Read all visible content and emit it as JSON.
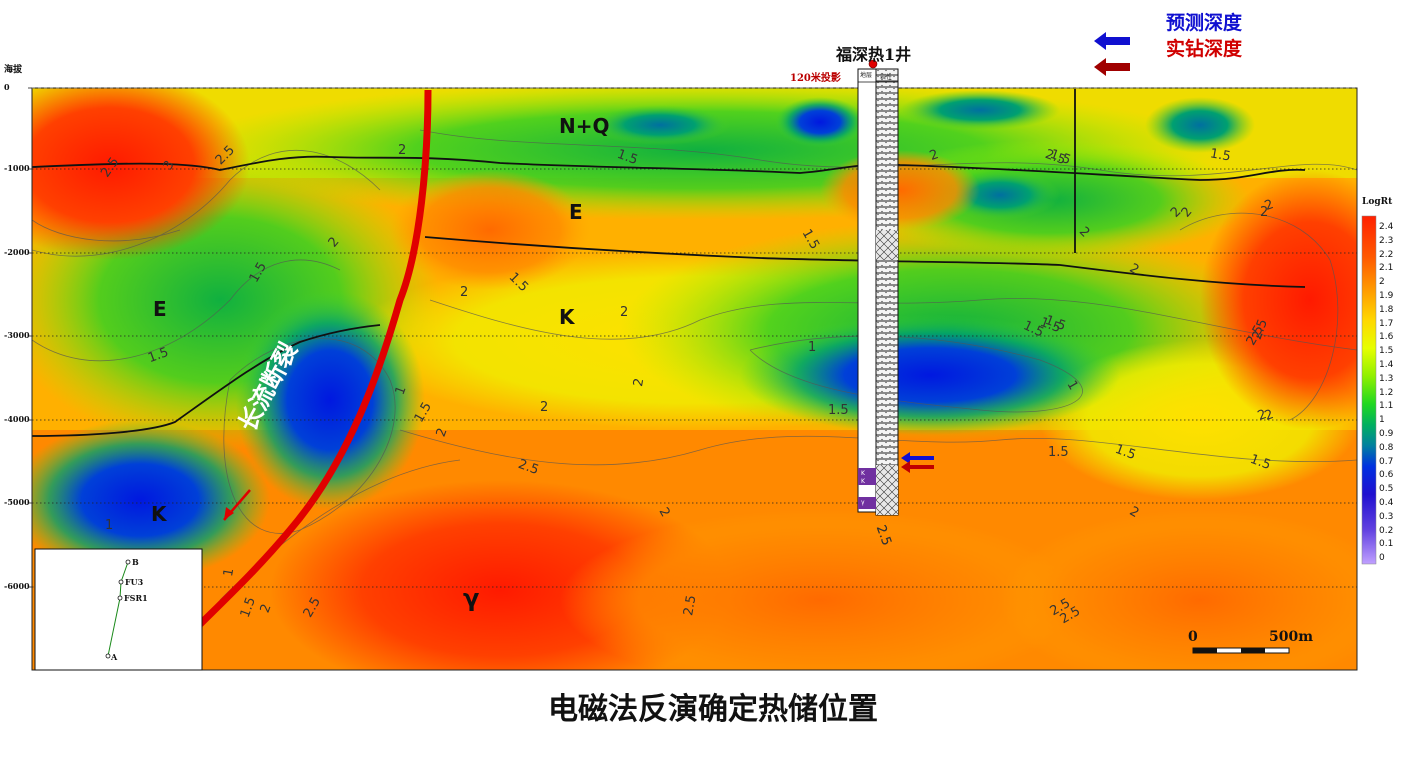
{
  "caption": "电磁法反演确定热储位置",
  "legend": {
    "predicted": "预测深度",
    "predicted_color": "#1010d0",
    "actual": "实钻深度",
    "actual_color": "#c00000"
  },
  "well": {
    "name": "福深热1井",
    "projection": "120米投影",
    "col_left": "地层",
    "col_right": "岩性"
  },
  "axis": {
    "ylabel": "海拔",
    "ticks": [
      "0",
      "-1000",
      "-2000",
      "-3000",
      "-4000",
      "-5000",
      "-6000"
    ]
  },
  "colorbar": {
    "title": "LogRt",
    "ticks": [
      "2.4",
      "2.3",
      "2.2",
      "2.1",
      "2",
      "1.9",
      "1.8",
      "1.7",
      "1.6",
      "1.5",
      "1.4",
      "1.3",
      "1.2",
      "1.1",
      "1",
      "0.9",
      "0.8",
      "0.7",
      "0.6",
      "0.5",
      "0.4",
      "0.3",
      "0.2",
      "0.1",
      "0"
    ]
  },
  "units": {
    "nq": "N+Q",
    "e_top": "E",
    "e_left": "E",
    "k_mid": "K",
    "k_left": "K",
    "granite": "γ"
  },
  "fault": {
    "label": "长流断裂",
    "color": "#e00000"
  },
  "scale": {
    "start": "0",
    "end": "500m"
  },
  "inset": {
    "points": [
      "B",
      "FU3",
      "FSR1",
      "A"
    ]
  },
  "contours": [
    "2.5",
    "3",
    "2.5",
    "2",
    "1.5",
    "2",
    "1.5",
    "1.5",
    "2",
    "1.5",
    "2",
    "2",
    "1.5",
    "2",
    "2",
    "2.5",
    "2",
    "1.5",
    "2",
    "2",
    "1.5",
    "2.5",
    "1.5",
    "1",
    "1.5",
    "1",
    "2",
    "2",
    "1",
    "2.5",
    "1.5",
    "1.5",
    "2",
    "2",
    "1",
    "2.5",
    "2",
    "1.5",
    "2.5",
    "2",
    "2.5",
    "2.5",
    "2.5",
    "1.5",
    "1.5",
    "1",
    "2",
    "1.5",
    "2.5",
    "2",
    "1.5",
    "2",
    "2.5"
  ],
  "strata_top": [
    "地",
    "层"
  ],
  "litho_tags": [
    "K",
    "K",
    "γ"
  ]
}
